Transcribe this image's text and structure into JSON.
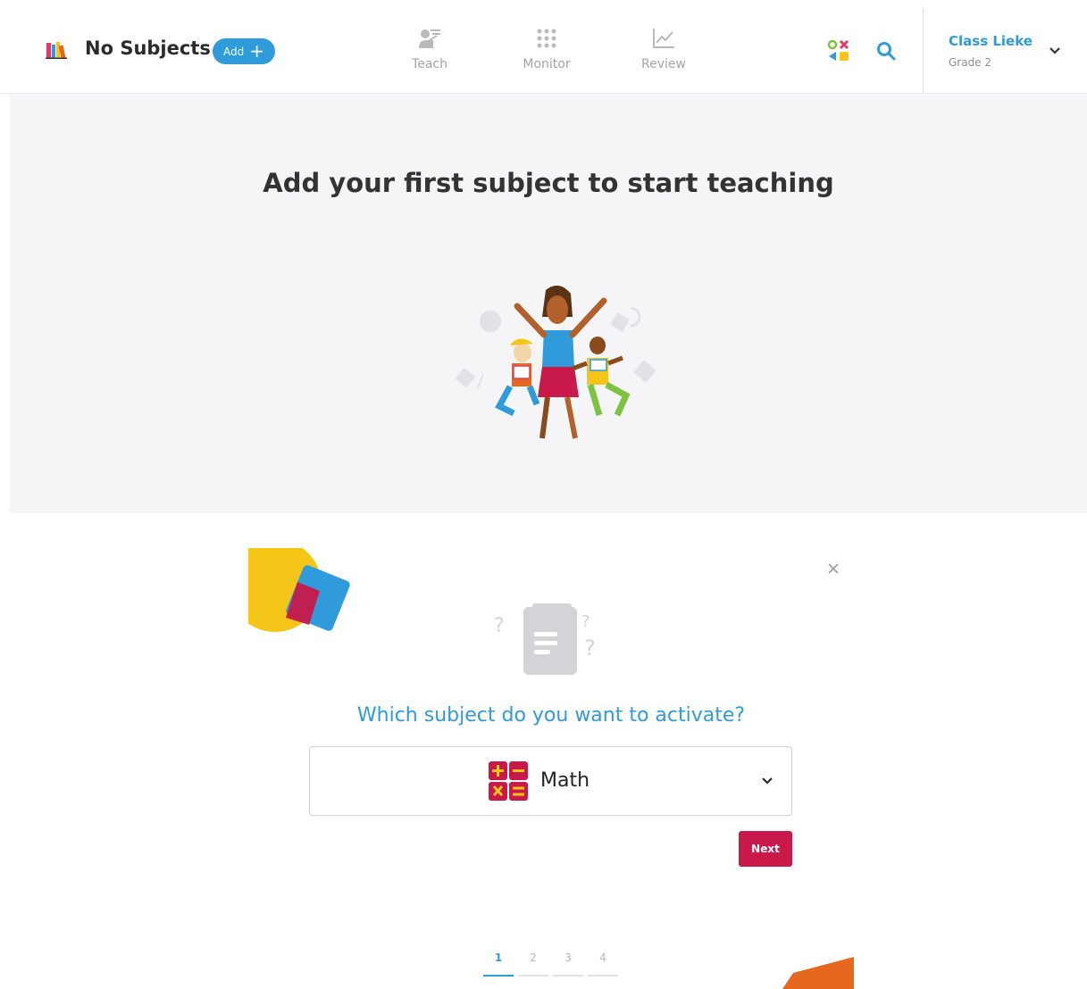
{
  "header": {
    "title": "No Subjects",
    "add_label": "Add",
    "nav": [
      {
        "label": "Teach",
        "icon": "teach-icon"
      },
      {
        "label": "Monitor",
        "icon": "grid-dots-icon"
      },
      {
        "label": "Review",
        "icon": "line-chart-icon"
      }
    ],
    "class_name": "Class Lieke",
    "class_grade": "Grade 2"
  },
  "hero": {
    "title": "Add your first subject to start teaching"
  },
  "modal": {
    "question": "Which subject do you want to activate?",
    "selected_subject": "Math",
    "next_label": "Next",
    "steps": [
      "1",
      "2",
      "3",
      "4"
    ],
    "active_step": 1
  },
  "colors": {
    "accent_blue": "#2f9bdb",
    "next_red": "#c8194a",
    "hero_bg": "#f5f5f7",
    "nav_gray": "#a4a4a8"
  }
}
